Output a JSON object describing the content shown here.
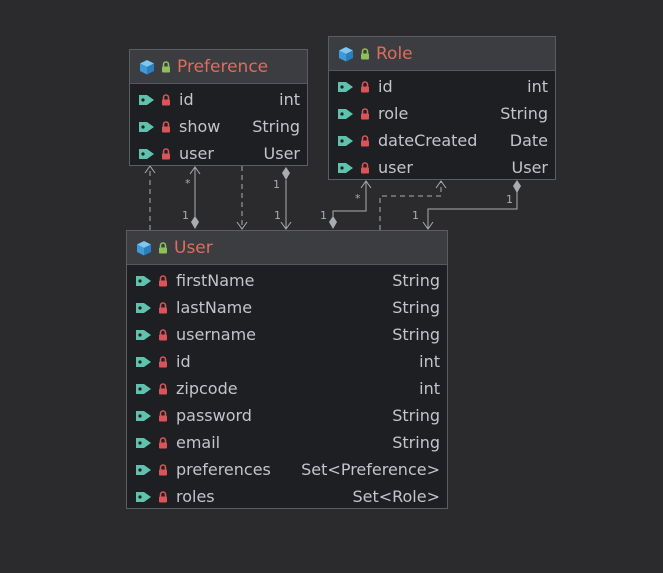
{
  "classes": {
    "preference": {
      "name": "Preference",
      "fields": [
        {
          "name": "id",
          "type": "int"
        },
        {
          "name": "show",
          "type": "String"
        },
        {
          "name": "user",
          "type": "User"
        }
      ]
    },
    "role": {
      "name": "Role",
      "fields": [
        {
          "name": "id",
          "type": "int"
        },
        {
          "name": "role",
          "type": "String"
        },
        {
          "name": "dateCreated",
          "type": "Date"
        },
        {
          "name": "user",
          "type": "User"
        }
      ]
    },
    "user": {
      "name": "User",
      "fields": [
        {
          "name": "firstName",
          "type": "String"
        },
        {
          "name": "lastName",
          "type": "String"
        },
        {
          "name": "username",
          "type": "String"
        },
        {
          "name": "id",
          "type": "int"
        },
        {
          "name": "zipcode",
          "type": "int"
        },
        {
          "name": "password",
          "type": "String"
        },
        {
          "name": "email",
          "type": "String"
        },
        {
          "name": "preferences",
          "type": "Set<Preference>"
        },
        {
          "name": "roles",
          "type": "Set<Role>"
        }
      ]
    }
  },
  "multiplicities": {
    "pref_user_many": "*",
    "pref_user_one_a": "1",
    "pref_user_one_b": "1",
    "pref_user_one_c": "1",
    "role_user_many": "*",
    "role_user_one_a": "1",
    "role_user_one_b": "1",
    "role_user_one_c": "1"
  },
  "colors": {
    "background": "#2b2b2d",
    "class_title": "#e06c5c",
    "field_text": "#c2c5ca",
    "class_icon": "#4aa8e0",
    "field_icon": "#5fc2ad",
    "private_lock": "#d9555a",
    "public_lock": "#8fbf5a",
    "edge": "#a9acb2"
  }
}
